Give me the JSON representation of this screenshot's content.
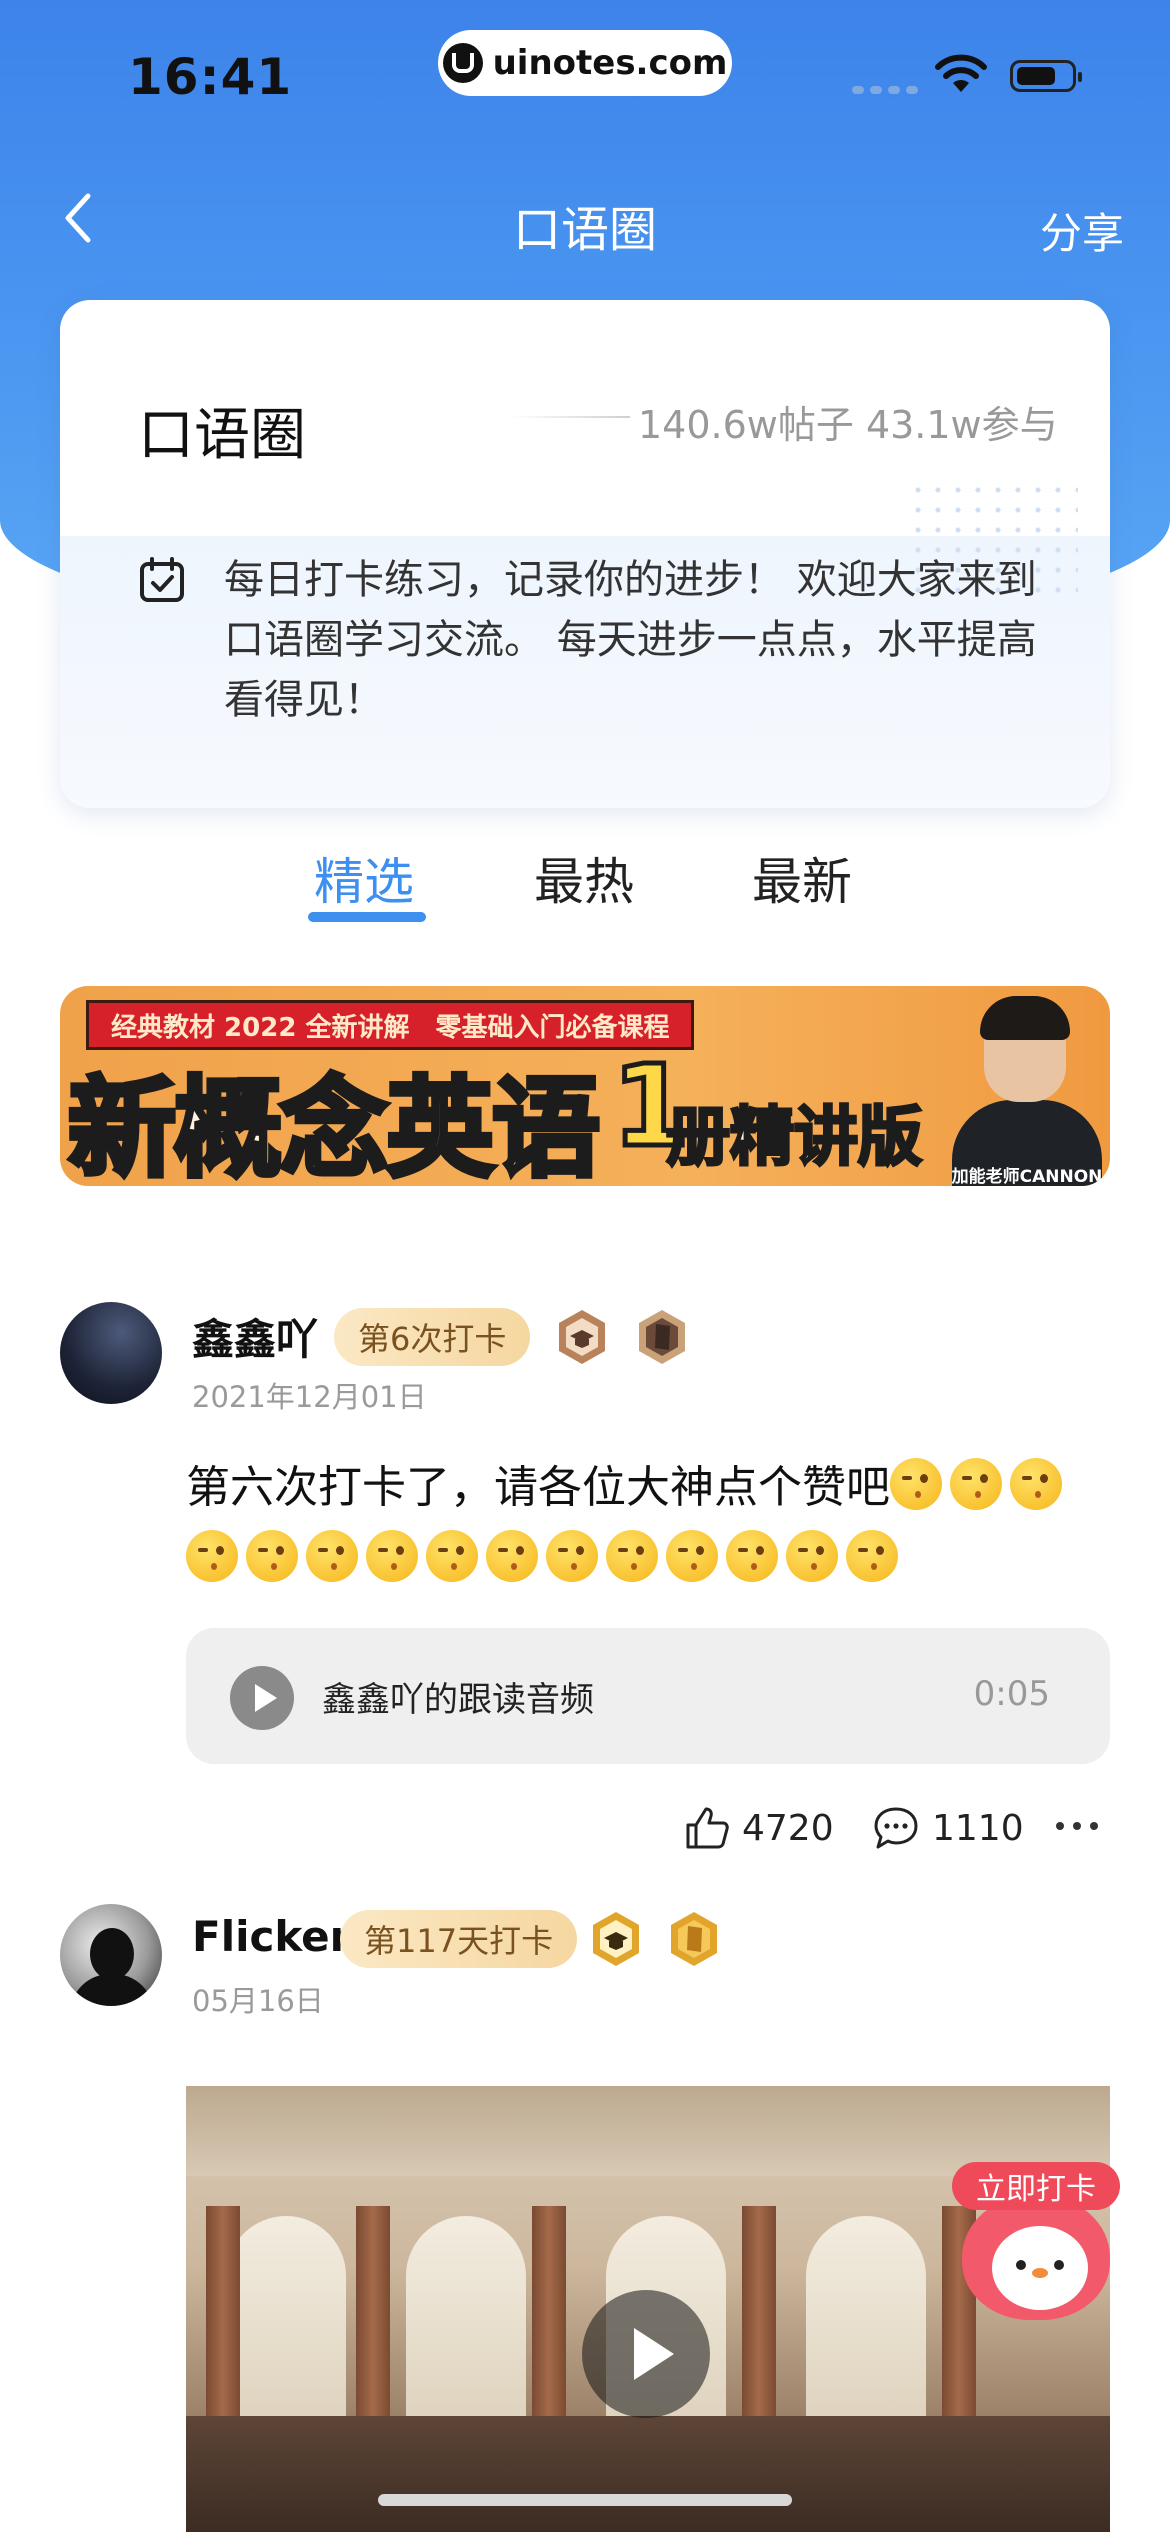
{
  "status_bar": {
    "time": "16:41",
    "url": "uinotes.com"
  },
  "nav": {
    "title": "口语圈",
    "share": "分享"
  },
  "info_card": {
    "title": "口语圈",
    "stats": "140.6w帖子 43.1w参与",
    "description": "每日打卡练习，记录你的进步！ 欢迎大家来到口语圈学习交流。 每天进步一点点，水平提高看得见！"
  },
  "tabs": [
    {
      "label": "精选",
      "active": true
    },
    {
      "label": "最热",
      "active": false
    },
    {
      "label": "最新",
      "active": false
    }
  ],
  "banner": {
    "top_text": "经典教材 2022 全新讲解　零基础入门必备课程",
    "main_text": "新概念英语",
    "number": "1",
    "sub_text": "册精讲版",
    "teacher_label": "加能老师CANNON"
  },
  "posts": [
    {
      "username": "鑫鑫吖",
      "badge": "第6次打卡",
      "date": "2021年12月01日",
      "text": "第六次打卡了，请各位大神点个赞吧",
      "audio": {
        "title": "鑫鑫吖的跟读音频",
        "duration": "0:05"
      },
      "likes": "4720",
      "comments": "1110"
    },
    {
      "username": "Flicker",
      "badge": "第117天打卡",
      "date": "05月16日"
    }
  ],
  "fab": {
    "label": "立即打卡"
  },
  "colors": {
    "accent": "#3d8ff0",
    "header": "#4b97f1",
    "badge_bg": "#f5d7a0",
    "fab": "#f2596a"
  }
}
